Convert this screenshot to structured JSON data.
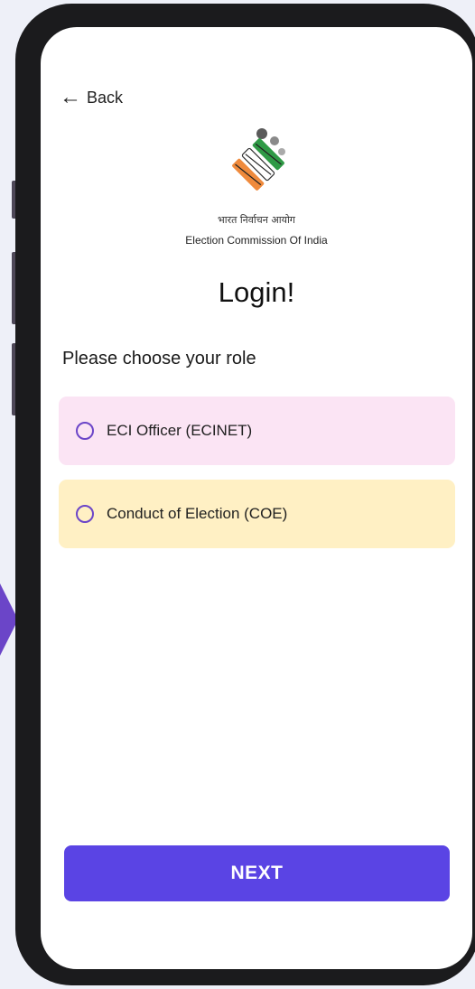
{
  "header": {
    "back_label": "Back"
  },
  "org": {
    "name_hindi": "भारत निर्वाचन आयोग",
    "name_english": "Election Commission Of India"
  },
  "login": {
    "title": "Login!",
    "prompt": "Please choose your role",
    "options": [
      {
        "label": "ECI Officer (ECINET)",
        "color": "#fbe4f4"
      },
      {
        "label": "Conduct of Election (COE)",
        "color": "#fff0c4"
      }
    ],
    "next_label": "NEXT"
  },
  "colors": {
    "accent": "#6b45c8",
    "button": "#5a44e4"
  }
}
